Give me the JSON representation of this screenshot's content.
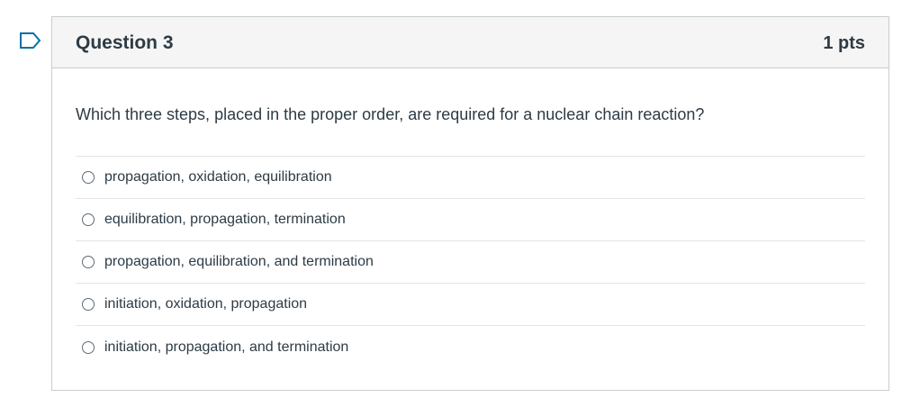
{
  "question": {
    "title": "Question 3",
    "points": "1 pts",
    "text": "Which three steps, placed in the proper order, are required for a nuclear chain reaction?",
    "answers": [
      {
        "label": "propagation, oxidation, equilibration"
      },
      {
        "label": "equilibration, propagation, termination"
      },
      {
        "label": "propagation, equilibration, and termination"
      },
      {
        "label": "initiation, oxidation, propagation"
      },
      {
        "label": "initiation, propagation, and termination"
      }
    ]
  },
  "icons": {
    "flag": "flag-outline-icon",
    "radio": "radio-unchecked-icon"
  },
  "colors": {
    "flag_stroke": "#0770a3",
    "header_bg": "#f5f5f5",
    "text": "#2d3b45",
    "border": "#c7cdd1"
  }
}
